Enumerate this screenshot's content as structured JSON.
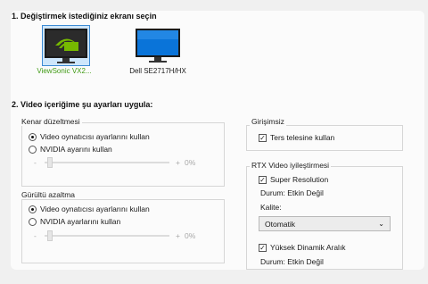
{
  "section1": {
    "title": "1. Değiştirmek istediğiniz ekranı seçin"
  },
  "monitors": [
    {
      "label": "ViewSonic VX2...",
      "selected": true,
      "label_color": "#3f9a13"
    },
    {
      "label": "Dell SE2717H/HX",
      "selected": false
    }
  ],
  "section2": {
    "title": "2. Video içeriğime şu ayarları uygula:"
  },
  "edge": {
    "legend": "Kenar düzeltmesi",
    "option1": "Video oynatıcısı ayarlarını kullan",
    "option2": "NVIDIA ayarını kullan",
    "selected": 0,
    "minus": "-",
    "plus": "+",
    "value": "0%"
  },
  "noise": {
    "legend": "Gürültü azaltma",
    "option1": "Video oynatıcısı ayarlarını kullan",
    "option2": "NVIDIA ayarlarını kullan",
    "selected": 0,
    "minus": "-",
    "plus": "+",
    "value": "0%"
  },
  "interlace": {
    "legend": "Girişimsiz",
    "checkbox": "Ters telesine kullan",
    "checked": true
  },
  "rtx": {
    "legend": "RTX Video iyileştirmesi",
    "super_res": "Super Resolution",
    "super_res_checked": true,
    "status1": "Durum: Etkin Değil",
    "quality_label": "Kalite:",
    "quality_value": "Otomatik",
    "hdr": "Yüksek Dinamik Aralık",
    "hdr_checked": true,
    "status2": "Durum: Etkin Değil"
  },
  "colors": {
    "accent": "#76b900",
    "monitor_border": "#3d8bd4"
  }
}
